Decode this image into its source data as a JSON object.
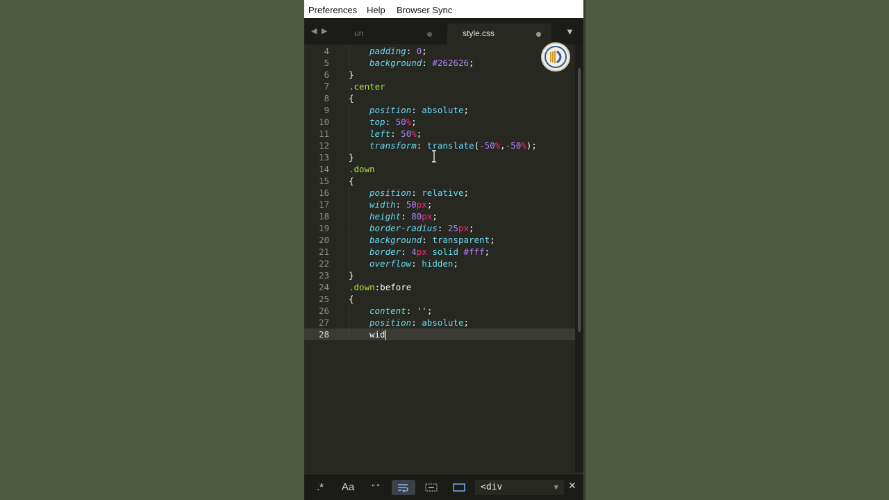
{
  "menubar": {
    "items": [
      "Preferences",
      "Help",
      "Browser Sync"
    ]
  },
  "tabs": [
    {
      "label": "un",
      "modified": true
    },
    {
      "label": "style.css",
      "modified": true
    }
  ],
  "editor": {
    "current_line": 28,
    "lines": [
      {
        "n": "4",
        "indent": true,
        "text": "padding: 0;"
      },
      {
        "n": "5",
        "indent": true,
        "text": "background: #262626;"
      },
      {
        "n": "6",
        "indent": false,
        "text": "}"
      },
      {
        "n": "7",
        "indent": false,
        "text": ".center"
      },
      {
        "n": "8",
        "indent": false,
        "text": "{"
      },
      {
        "n": "9",
        "indent": true,
        "text": "position: absolute;"
      },
      {
        "n": "10",
        "indent": true,
        "text": "top: 50%;"
      },
      {
        "n": "11",
        "indent": true,
        "text": "left: 50%;"
      },
      {
        "n": "12",
        "indent": true,
        "text": "transform: translate(-50%,-50%);"
      },
      {
        "n": "13",
        "indent": false,
        "text": "}"
      },
      {
        "n": "14",
        "indent": false,
        "text": ".down"
      },
      {
        "n": "15",
        "indent": false,
        "text": "{"
      },
      {
        "n": "16",
        "indent": true,
        "text": "position: relative;"
      },
      {
        "n": "17",
        "indent": true,
        "text": "width: 50px;"
      },
      {
        "n": "18",
        "indent": true,
        "text": "height: 80px;"
      },
      {
        "n": "19",
        "indent": true,
        "text": "border-radius: 25px;"
      },
      {
        "n": "20",
        "indent": true,
        "text": "background: transparent;"
      },
      {
        "n": "21",
        "indent": true,
        "text": "border: 4px solid #fff;"
      },
      {
        "n": "22",
        "indent": true,
        "text": "overflow: hidden;"
      },
      {
        "n": "23",
        "indent": false,
        "text": "}"
      },
      {
        "n": "24",
        "indent": false,
        "text": ".down:before"
      },
      {
        "n": "25",
        "indent": false,
        "text": "{"
      },
      {
        "n": "26",
        "indent": true,
        "text": "content: '';"
      },
      {
        "n": "27",
        "indent": true,
        "text": "position: absolute;"
      },
      {
        "n": "28",
        "indent": true,
        "text": "wid"
      }
    ]
  },
  "findbar": {
    "regex_label": ".*",
    "case_label": "Aa",
    "word_label": "“ ”",
    "input_value": "<div"
  },
  "colors": {
    "background": "#272822",
    "property": "#66d9ef",
    "number": "#ae81ff",
    "unit": "#f92672",
    "selector": "#a6e22e"
  },
  "icons": [
    "nav-back-icon",
    "nav-forward-icon",
    "tab-dropdown-icon",
    "wrap-icon",
    "selection-icon",
    "highlight-icon",
    "close-icon",
    "avatar-logo-icon"
  ]
}
